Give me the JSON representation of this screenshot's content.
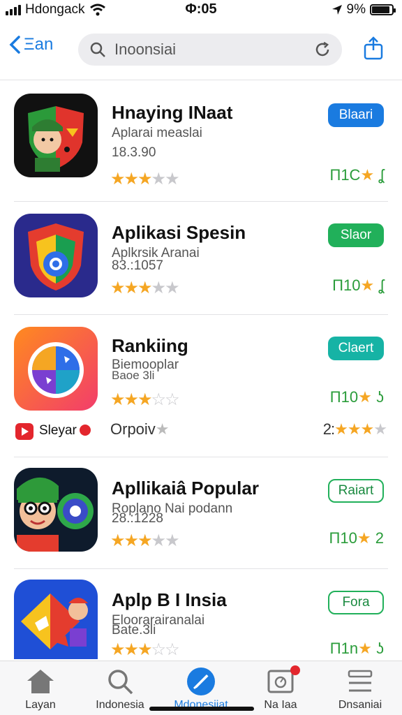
{
  "status": {
    "carrier": "Hdongack",
    "time": "Φ:05",
    "battery": "9%",
    "battery_level": 0.9
  },
  "nav": {
    "back_label": "Ξan",
    "search_placeholder": "Inoonsiai"
  },
  "apps": [
    {
      "title": "Hnaying INaat",
      "subtitle": "Aplarai measlai",
      "meta": "18.3.90",
      "rating": 3,
      "button": "Blaari",
      "button_color": "#1a7be0",
      "rank": "Π1C",
      "rank_suffix": "ʆ"
    },
    {
      "title": "Aplikasi Spesin",
      "subtitle": "Aplkrsik Aranai",
      "meta": "83.:1057",
      "rating": 3,
      "button": "Slaor",
      "button_color": "#21b05a",
      "rank": "Π10",
      "rank_suffix": "ʆ"
    },
    {
      "title": "Rankiing",
      "subtitle": "Biemooplar",
      "meta": "Baoe 3li",
      "rating": 3,
      "button": "Claert",
      "button_color": "#16b3a5",
      "rank": "Π10",
      "rank_suffix": "ʖ"
    },
    {
      "title": "Apllikaiâ Popular",
      "subtitle": "Roplano Nai podann",
      "meta": "28.:1228",
      "rating": 3,
      "button": "Raiart",
      "button_color": "outline",
      "rank": "Π10",
      "rank_suffix": "2"
    },
    {
      "title": "Aplp B I Insia",
      "subtitle": "Eloorarairanalai",
      "meta": "Bate.3li",
      "rating": 3,
      "button": "Fora",
      "button_color": "outline",
      "rank": "Π1n",
      "rank_suffix": "ʖ"
    }
  ],
  "promo": {
    "label": "Sleyar",
    "middle": "Orpoiv",
    "right": "2:"
  },
  "tabs": [
    {
      "label": "Layan",
      "icon": "home-icon"
    },
    {
      "label": "Indonesia",
      "icon": "search-icon"
    },
    {
      "label": "Mdonesiiat",
      "icon": "compass-icon"
    },
    {
      "label": "Na Iaa",
      "icon": "inbox-icon"
    },
    {
      "label": "Dnsaniai",
      "icon": "menu-icon"
    }
  ]
}
